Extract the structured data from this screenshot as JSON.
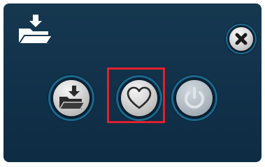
{
  "window": {
    "title_icon": "folder-download-icon"
  },
  "toolbar": {
    "close_icon": "close-icon"
  },
  "actions": [
    {
      "id": "load",
      "icon": "folder-download-icon",
      "enabled": true
    },
    {
      "id": "favorites",
      "icon": "heart-icon",
      "enabled": true,
      "highlighted": true
    },
    {
      "id": "power",
      "icon": "power-icon",
      "enabled": false
    }
  ],
  "colors": {
    "panel_background": "#12344c",
    "ring": "#1c688c",
    "button_face": "#d8d8d8",
    "highlight": "#e2202c"
  }
}
